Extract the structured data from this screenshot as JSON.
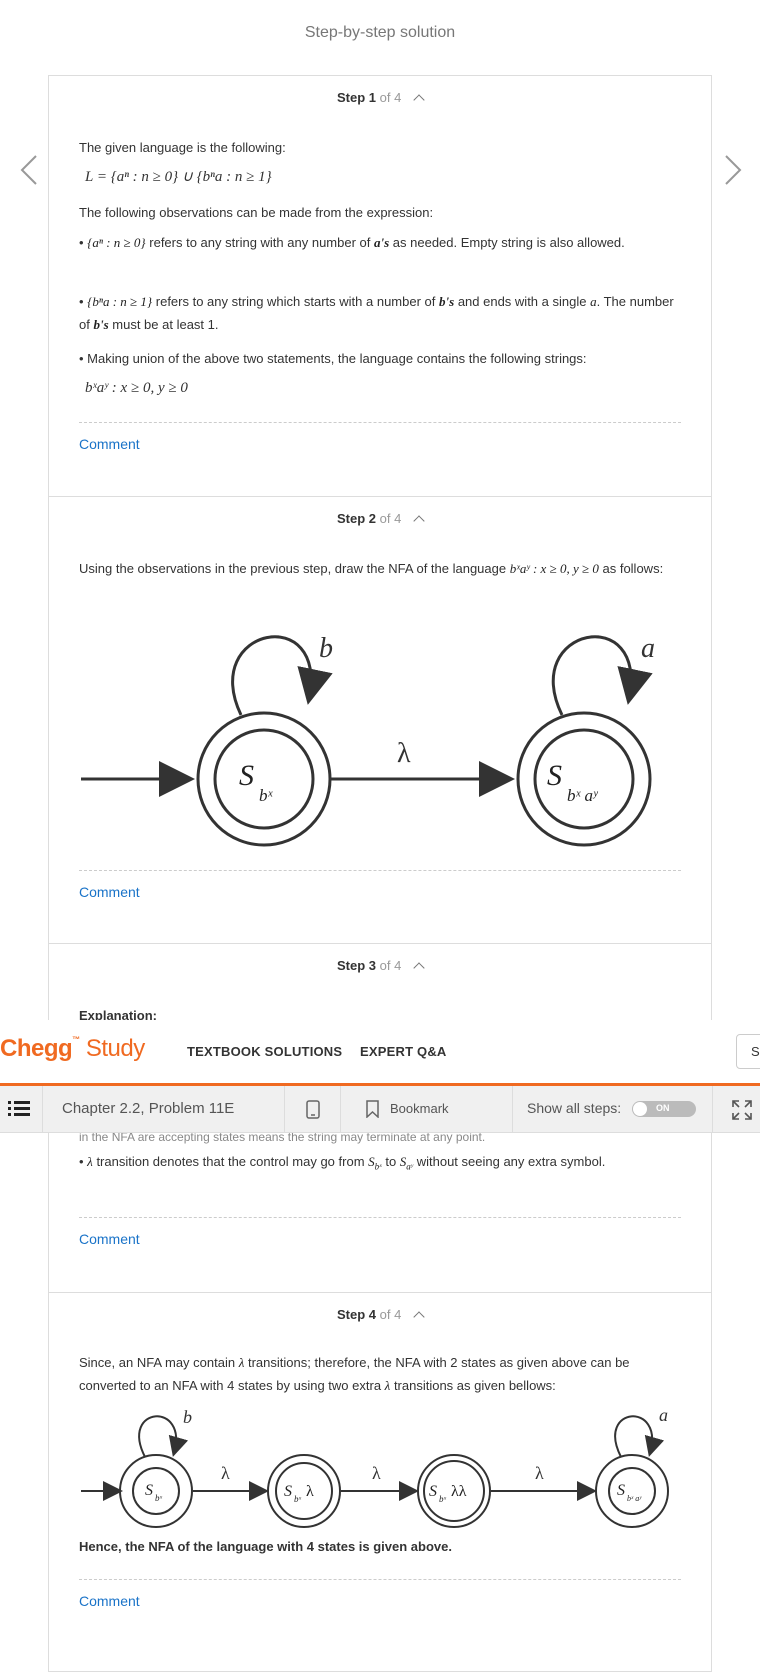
{
  "page": {
    "heading": "Step-by-step solution",
    "prev_icon": "chevron-left-icon",
    "next_icon": "chevron-right-icon"
  },
  "step1": {
    "label": "Step 1",
    "of": "of 4",
    "intro": "The given language is the following:",
    "formula_L": "L = {aⁿ : n ≥ 0} ∪ {bⁿa : n ≥ 1}",
    "observations": "The following observations can be made from the expression:",
    "bullet1_math": "{aⁿ : n ≥ 0}",
    "bullet1_a": "refers to any string with any number of",
    "bullet1_var": "a's",
    "bullet1_b": "as needed. Empty string is also allowed.",
    "bullet2_math": "{bⁿa : n ≥ 1}",
    "bullet2_a": "refers to any string which starts with a number of",
    "bullet2_var": "b's",
    "bullet2_b": "and ends with a single",
    "bullet2_var2": "a",
    "bullet2_c": "The number of",
    "bullet2_var3": "b's",
    "bullet2_d": "must be at least 1.",
    "bullet3": "• Making union of the above two statements, the language contains the following strings:",
    "formula_strings": "bˣaʸ : x ≥ 0, y ≥ 0",
    "comment": "Comment"
  },
  "step2": {
    "label": "Step 2",
    "of": "of 4",
    "text_a": "Using the observations in the previous step, draw the NFA of the language",
    "text_math": "bˣaʸ : x ≥ 0, y ≥ 0",
    "text_b": "as follows:",
    "diagram": {
      "loop1": "b",
      "loop2": "a",
      "edge": "λ",
      "state1": "S",
      "state1_sub": "bˣ",
      "state2": "S",
      "state2_sub": "bˣ aʸ"
    },
    "comment": "Comment"
  },
  "step3": {
    "label": "Step 3",
    "of": "of 4",
    "explanation": "Explanation:",
    "partial_line": "in the NFA are accepting states means the string may terminate at any point.",
    "bullet_a": "transition denotes that the control may go from",
    "bullet_lambda": "λ",
    "bullet_from": "S",
    "bullet_from_sub": "bˣ",
    "bullet_to_word": "to",
    "bullet_to": "S",
    "bullet_to_sub": "aʸ",
    "bullet_b": "without seeing any extra symbol.",
    "comment": "Comment"
  },
  "step4": {
    "label": "Step 4",
    "of": "of 4",
    "text_a": "Since, an NFA may contain",
    "text_lambda": "λ",
    "text_b": "transitions; therefore, the NFA with 2 states as given above can be converted to an NFA with 4 states by using two extra",
    "text_c": "transitions as given bellows:",
    "diagram": {
      "loop1": "b",
      "loop4": "a",
      "e1": "λ",
      "e2": "λ",
      "e3": "λ",
      "s1": "S",
      "s1_sub": "bˣ",
      "s2": "S",
      "s2_sub": "bˣ",
      "s2_suffix": "λ",
      "s3": "S",
      "s3_sub": "bˣ",
      "s3_suffix": "λλ",
      "s4": "S",
      "s4_sub": "bˣ aʸ"
    },
    "conclusion": "Hence, the NFA of the language with 4 states is given above.",
    "comment": "Comment"
  },
  "header": {
    "logo_chegg": "Chegg",
    "logo_study": "Study",
    "nav1": "TEXTBOOK SOLUTIONS",
    "nav2": "EXPERT Q&A",
    "search_stub": "S"
  },
  "toolbar": {
    "chapter": "Chapter 2.2, Problem 11E",
    "bookmark": "Bookmark",
    "show_all": "Show all steps:",
    "toggle_label": "ON",
    "colors": {
      "accent": "#f06a21",
      "link": "#1a73c8"
    }
  }
}
